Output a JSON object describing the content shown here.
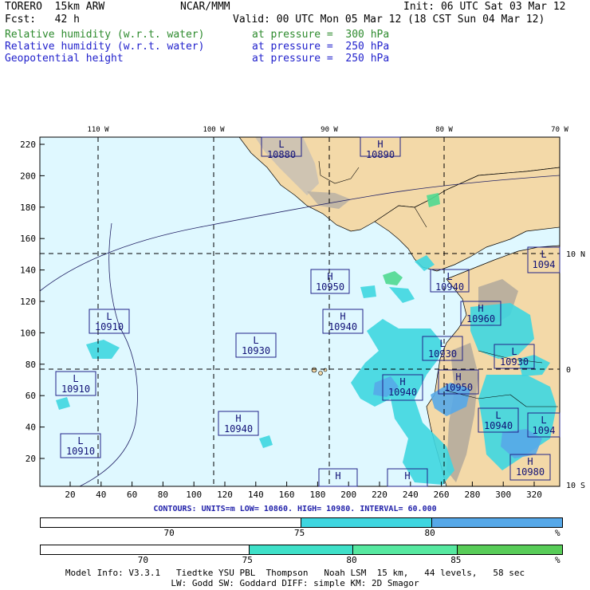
{
  "header": {
    "model": "TORERO  15km ARW",
    "org": "NCAR/MMM",
    "init": "Init: 06 UTC Sat 03 Mar 12",
    "fcst": "Fcst:   42 h",
    "valid": "Valid: 00 UTC Mon 05 Mar 12 (18 CST Sun 04 Mar 12)",
    "fields": [
      {
        "name": "Relative humidity (w.r.t. water)",
        "level": "at pressure =  300 hPa",
        "color": "#2e8b2e"
      },
      {
        "name": "Relative humidity (w.r.t. water)",
        "level": "at pressure =  250 hPa",
        "color": "#2222cc"
      },
      {
        "name": "Geopotential height",
        "level": "at pressure =  250 hPa",
        "color": "#2222cc"
      }
    ]
  },
  "map": {
    "colors": {
      "ocean": "#dff8ff",
      "land": "#f3d9a8",
      "terrain": "#c8c0b4",
      "rh75": "#3ed6e0",
      "rh80": "#56a8e8",
      "rh_green": "#4fd890"
    },
    "lon_labels": [
      "110 W",
      "100 W",
      "90 W",
      "80 W",
      "70 W"
    ],
    "lat_labels": [
      "10 N",
      "0",
      "10 S"
    ],
    "y_ticks": [
      "220",
      "200",
      "180",
      "160",
      "140",
      "120",
      "100",
      "80",
      "60",
      "40",
      "20"
    ],
    "x_ticks": [
      "20",
      "40",
      "60",
      "80",
      "100",
      "120",
      "140",
      "160",
      "180",
      "200",
      "220",
      "240",
      "260",
      "280",
      "300",
      "320"
    ],
    "centers": [
      {
        "type": "L",
        "value": "10880"
      },
      {
        "type": "H",
        "value": "10890"
      },
      {
        "type": "H",
        "value": "10950"
      },
      {
        "type": "L",
        "value": "10940"
      },
      {
        "type": "L",
        "value": "1094"
      },
      {
        "type": "H",
        "value": "10960"
      },
      {
        "type": "L",
        "value": "10910"
      },
      {
        "type": "H",
        "value": "10940"
      },
      {
        "type": "L",
        "value": "10930"
      },
      {
        "type": "L",
        "value": "10930"
      },
      {
        "type": "L",
        "value": "10930"
      },
      {
        "type": "L",
        "value": "10910"
      },
      {
        "type": "H",
        "value": "10940"
      },
      {
        "type": "H",
        "value": "10950"
      },
      {
        "type": "H",
        "value": "10940"
      },
      {
        "type": "L",
        "value": "10940"
      },
      {
        "type": "L",
        "value": "1094"
      },
      {
        "type": "L",
        "value": "10910"
      },
      {
        "type": "H",
        "value": "10980"
      },
      {
        "type": "H",
        "value": ""
      },
      {
        "type": "H",
        "value": ""
      }
    ]
  },
  "contours": {
    "label": "CONTOURS:",
    "units": "UNITS=m",
    "low": "LOW=   10860.",
    "high": "HIGH=   10980.",
    "interval": "INTERVAL=    60.000"
  },
  "colorbar1": {
    "segments": [
      {
        "color": "#ffffff",
        "weight": 50
      },
      {
        "color": "#3ed6e0",
        "weight": 25
      },
      {
        "color": "#56a8e8",
        "weight": 25
      }
    ],
    "ticks": [
      "70",
      "75",
      "80",
      "%"
    ]
  },
  "colorbar2": {
    "segments": [
      {
        "color": "#ffffff",
        "weight": 40
      },
      {
        "color": "#3ee0c8",
        "weight": 20
      },
      {
        "color": "#56e8a0",
        "weight": 20
      },
      {
        "color": "#58cc58",
        "weight": 20
      }
    ],
    "ticks": [
      "70",
      "75",
      "80",
      "85",
      "%"
    ]
  },
  "footer": {
    "line1": "Model Info: V3.3.1   Tiedtke YSU PBL  Thompson   Noah LSM  15 km,   44 levels,   58 sec",
    "line2": "LW: Godd SW: Goddard DIFF: simple KM: 2D Smagor"
  }
}
